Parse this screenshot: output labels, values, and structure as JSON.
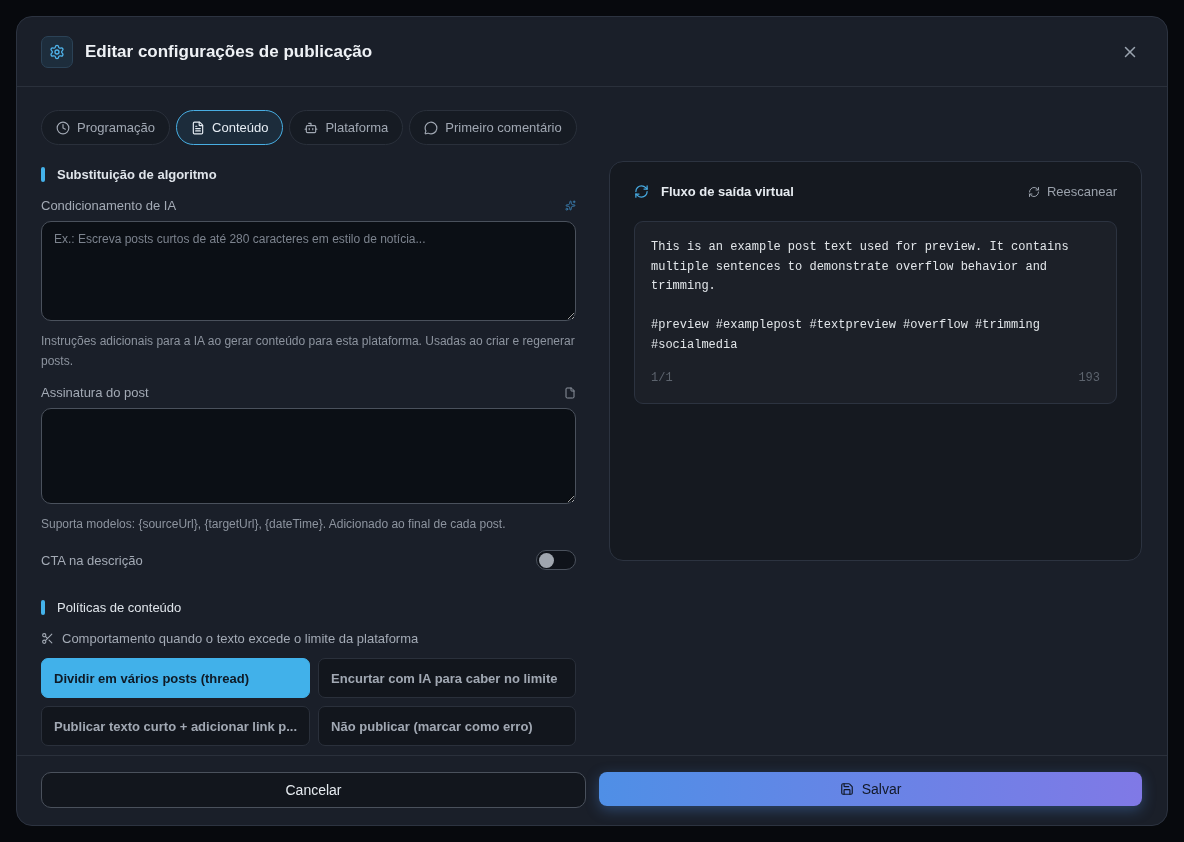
{
  "dialog": {
    "title": "Editar configurações de publicação"
  },
  "tabs": [
    {
      "label": "Programação",
      "selected": false
    },
    {
      "label": "Conteúdo",
      "selected": true
    },
    {
      "label": "Plataforma",
      "selected": false
    },
    {
      "label": "Primeiro comentário",
      "selected": false
    }
  ],
  "algorithm_section": {
    "heading": "Substituição de algoritmo",
    "ai_conditioning": {
      "label": "Condicionamento de IA",
      "placeholder": "Ex.: Escreva posts curtos de até 280 caracteres em estilo de notícia...",
      "help": "Instruções adicionais para a IA ao gerar conteúdo para esta plataforma. Usadas ao criar e regenerar posts."
    },
    "signature": {
      "label": "Assinatura do post",
      "help": "Suporta modelos: {sourceUrl}, {targetUrl}, {dateTime}. Adicionado ao final de cada post."
    },
    "cta": {
      "label": "CTA na descrição",
      "on": false
    }
  },
  "policies_section": {
    "heading": "Políticas de conteúdo",
    "overflow_label": "Comportamento quando o texto excede o limite da plataforma",
    "options": [
      {
        "label": "Dividir em vários posts (thread)",
        "selected": true
      },
      {
        "label": "Encurtar com IA para caber no limite",
        "selected": false
      },
      {
        "label": "Publicar texto curto + adicionar link p...",
        "selected": false
      },
      {
        "label": "Não publicar (marcar como erro)",
        "selected": false
      }
    ]
  },
  "preview": {
    "title": "Fluxo de saída virtual",
    "rescan": "Reescanear",
    "post_text": "This is an example post text used for preview. It contains multiple sentences to demonstrate overflow behavior and trimming.",
    "hashtags": "#preview #examplepost #textpreview #overflow #trimming #socialmedia",
    "page": "1/1",
    "char_count": "193"
  },
  "footer": {
    "cancel": "Cancelar",
    "save": "Salvar"
  }
}
